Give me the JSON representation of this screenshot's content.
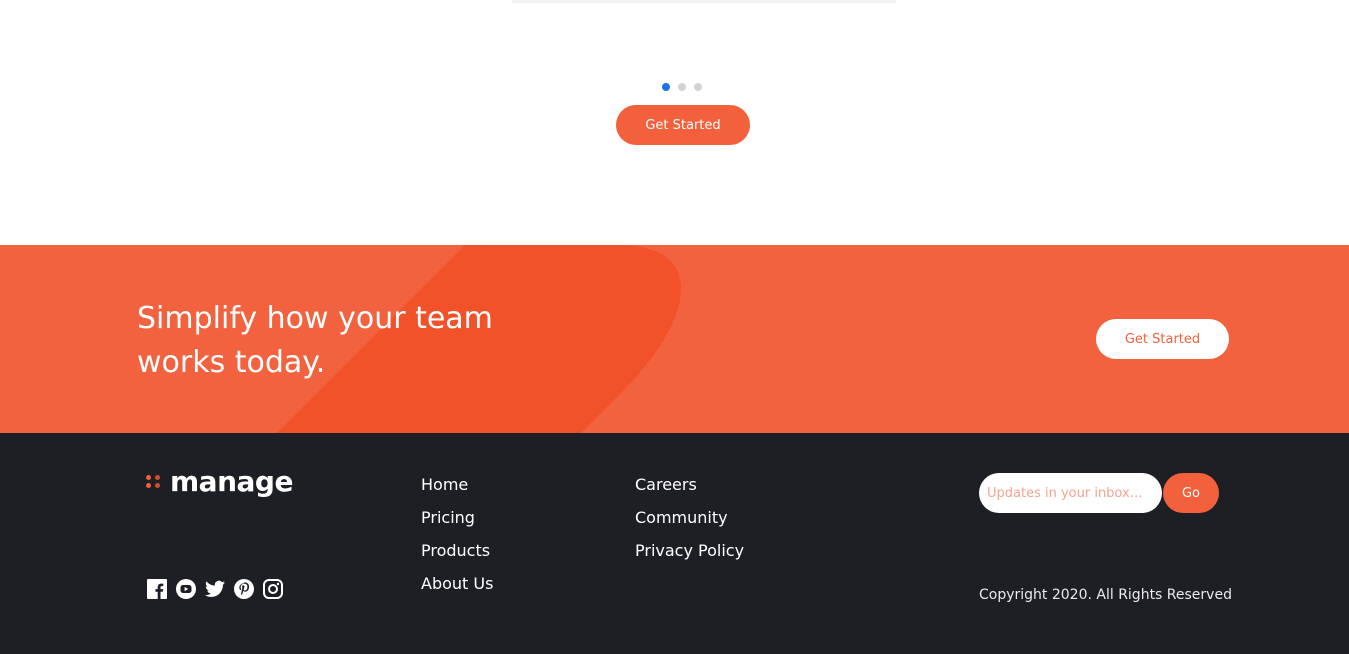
{
  "carousel": {
    "dots": [
      {
        "active": true
      },
      {
        "active": false
      },
      {
        "active": false
      }
    ],
    "cta_label": "Get Started"
  },
  "banner": {
    "title": "Simplify how your team works today.",
    "cta_label": "Get Started"
  },
  "footer": {
    "logo_text": "manage",
    "social_icons": [
      "facebook-icon",
      "youtube-icon",
      "twitter-icon",
      "pinterest-icon",
      "instagram-icon"
    ],
    "nav_col1": [
      "Home",
      "Pricing",
      "Products",
      "About Us"
    ],
    "nav_col2": [
      "Careers",
      "Community",
      "Privacy Policy"
    ],
    "subscribe": {
      "placeholder": "Updates in your inbox…",
      "button_label": "Go"
    },
    "copyright": "Copyright 2020. All Rights Reserved"
  },
  "colors": {
    "accent": "#f2603c",
    "banner_bg": "#f2623e",
    "footer_bg": "#1e1f25",
    "dot_active": "#1a73e8"
  }
}
